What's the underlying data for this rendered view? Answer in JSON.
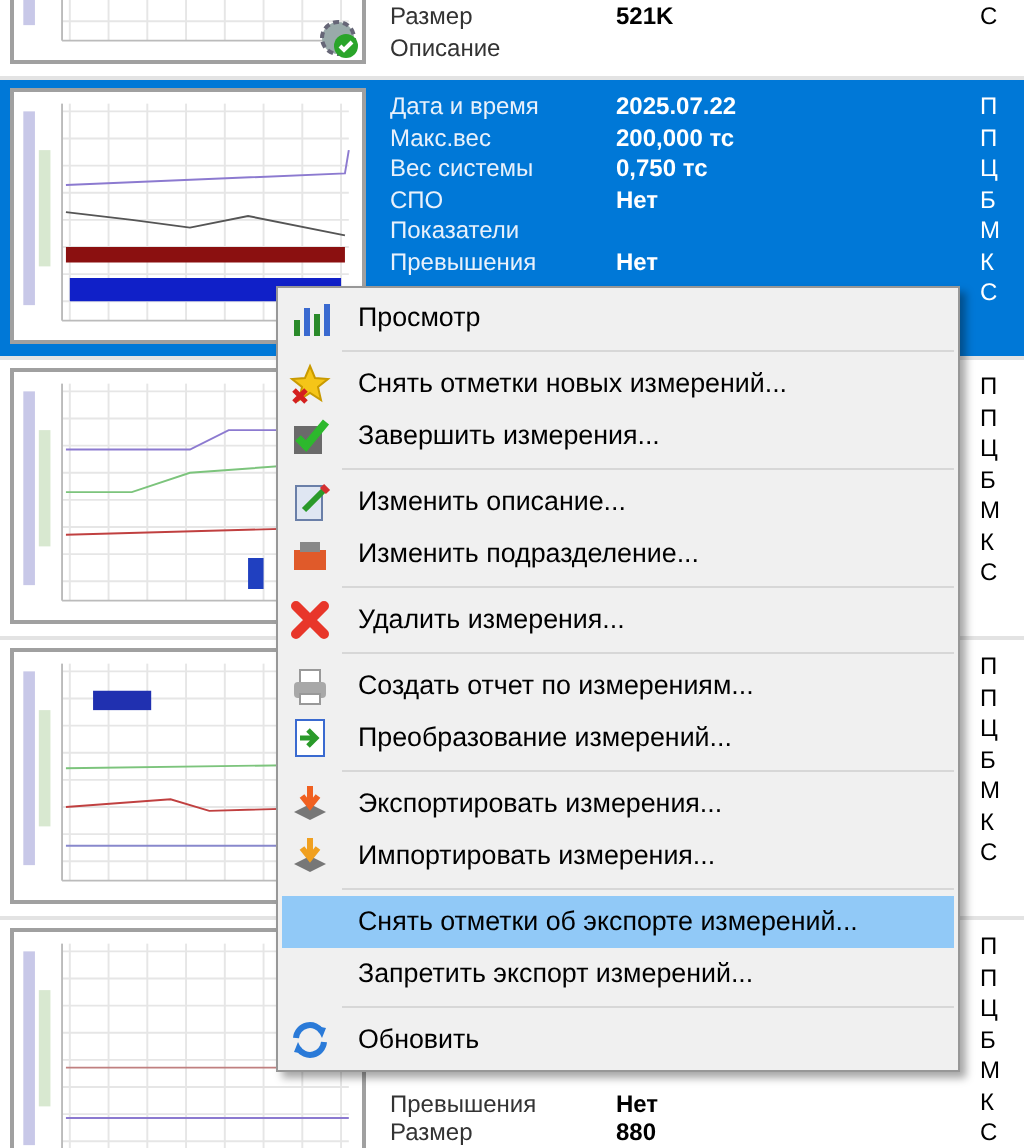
{
  "records": [
    {
      "selected": false,
      "fields": [
        {
          "label": "Размер",
          "value": "521K"
        },
        {
          "label": "Описание"
        }
      ],
      "side": [
        "С"
      ]
    },
    {
      "selected": true,
      "fields": [
        {
          "label": "Дата и время",
          "value": "2025.07.22"
        },
        {
          "label": "Макс.вес",
          "value": "200,000 тс"
        },
        {
          "label": "Вес системы",
          "value": "0,750 тс"
        },
        {
          "label": "СПО",
          "value": "Нет"
        },
        {
          "label": "Показатели"
        },
        {
          "label": "Превышения",
          "value": "Нет"
        }
      ],
      "side": [
        "П",
        "П",
        "Ц",
        "Б",
        "М",
        "К",
        "С"
      ]
    },
    {
      "selected": false,
      "side": [
        "П",
        "П",
        "Ц",
        "Б",
        "М",
        "К",
        "С"
      ]
    },
    {
      "selected": false,
      "side": [
        "П",
        "П",
        "Ц",
        "Б",
        "М",
        "К",
        "С"
      ]
    },
    {
      "selected": false,
      "fields": [
        {
          "label": "Превышения",
          "value": "Нет"
        },
        {
          "label": "Размер",
          "value": "880"
        }
      ],
      "side": [
        "П",
        "П",
        "Ц",
        "Б",
        "М",
        "К",
        "С"
      ]
    }
  ],
  "context_menu": {
    "items": [
      {
        "kind": "command",
        "label": "Просмотр",
        "selected": false
      },
      {
        "kind": "separator"
      },
      {
        "kind": "command",
        "label": "Снять отметки новых измерений...",
        "selected": false
      },
      {
        "kind": "command",
        "label": "Завершить измерения...",
        "selected": false
      },
      {
        "kind": "separator"
      },
      {
        "kind": "command",
        "label": "Изменить описание...",
        "selected": false
      },
      {
        "kind": "command",
        "label": "Изменить подразделение...",
        "selected": false
      },
      {
        "kind": "separator"
      },
      {
        "kind": "command",
        "label": "Удалить измерения...",
        "selected": false
      },
      {
        "kind": "separator"
      },
      {
        "kind": "command",
        "label": "Создать отчет по измерениям...",
        "selected": false
      },
      {
        "kind": "command",
        "label": "Преобразование измерений...",
        "selected": false
      },
      {
        "kind": "separator"
      },
      {
        "kind": "command",
        "label": "Экспортировать измерения...",
        "selected": false
      },
      {
        "kind": "command",
        "label": "Импортировать измерения...",
        "selected": false
      },
      {
        "kind": "separator"
      },
      {
        "kind": "command",
        "label": "Снять отметки об экспорте измерений...",
        "selected": true
      },
      {
        "kind": "command",
        "label": "Запретить экспорт измерений...",
        "selected": false
      },
      {
        "kind": "separator"
      },
      {
        "kind": "command",
        "label": "Обновить",
        "selected": false
      }
    ]
  }
}
